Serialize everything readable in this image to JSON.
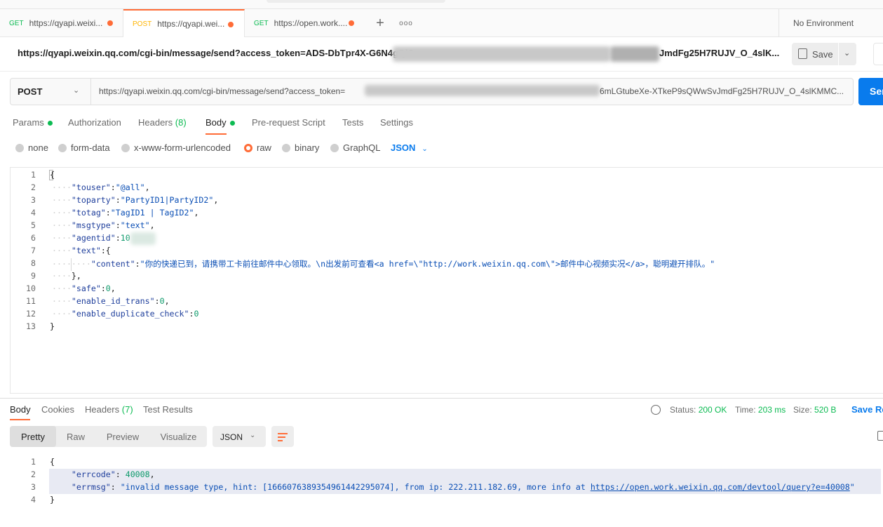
{
  "tabs": [
    {
      "method": "GET",
      "url": "https://qyapi.weixi..."
    },
    {
      "method": "POST",
      "url": "https://qyapi.wei..."
    },
    {
      "method": "GET",
      "url": "https://open.work...."
    }
  ],
  "new_tab": "+",
  "more_tabs": "ooo",
  "environment": "No Environment",
  "title_url": "https://qyapi.weixin.qq.com/cgi-bin/message/send?access_token=ADS-DbTpr4X-G6N4gQlS",
  "title_url_tail": "JmdFg25H7RUJV_O_4slK...",
  "save_label": "Save",
  "request": {
    "method": "POST",
    "url_prefix": "https://qyapi.weixin.qq.com/cgi-bin/message/send?access_token=",
    "url_tail": "6mLGtubeXe-XTkeP9sQWwSvJmdFg25H7RUJV_O_4slKMMC...",
    "send_label": "Send"
  },
  "request_tabs": {
    "params": "Params",
    "authorization": "Authorization",
    "headers": "Headers",
    "headers_count": "(8)",
    "body": "Body",
    "prerequest": "Pre-request Script",
    "tests": "Tests",
    "settings": "Settings"
  },
  "body_types": {
    "none": "none",
    "form_data": "form-data",
    "urlencoded": "x-www-form-urlencoded",
    "raw": "raw",
    "binary": "binary",
    "graphql": "GraphQL",
    "format": "JSON"
  },
  "request_body": {
    "line_numbers": [
      "1",
      "2",
      "3",
      "4",
      "5",
      "6",
      "7",
      "8",
      "9",
      "10",
      "11",
      "12",
      "13"
    ],
    "open_brace": "{",
    "touser_key": "\"touser\"",
    "touser_val": "\"@all\"",
    "toparty_key": "\"toparty\"",
    "toparty_val": "\"PartyID1|PartyID2\"",
    "totag_key": "\"totag\"",
    "totag_val": "\"TagID1 | TagID2\"",
    "msgtype_key": "\"msgtype\"",
    "msgtype_val": "\"text\"",
    "agentid_key": "\"agentid\"",
    "agentid_val": "10",
    "text_key": "\"text\"",
    "content_key": "\"content\"",
    "content_val": "\"你的快递已到，请携带工卡前往邮件中心领取。\\n出发前可查看<a href=\\\"http://work.weixin.qq.com\\\">邮件中心视频实况</a>，聪明避开排队。\"",
    "close_inner": "},",
    "safe_key": "\"safe\"",
    "safe_val": "0",
    "enable_id_trans_key": "\"enable_id_trans\"",
    "enable_id_trans_val": "0",
    "enable_duplicate_check_key": "\"enable_duplicate_check\"",
    "enable_duplicate_check_val": "0",
    "close_brace": "}"
  },
  "response_tabs": {
    "body": "Body",
    "cookies": "Cookies",
    "headers": "Headers",
    "headers_count": "(7)",
    "test_results": "Test Results"
  },
  "response_status": {
    "status_label": "Status:",
    "status_value": "200 OK",
    "time_label": "Time:",
    "time_value": "203 ms",
    "size_label": "Size:",
    "size_value": "520 B",
    "save_response": "Save Response"
  },
  "response_view": {
    "pretty": "Pretty",
    "raw": "Raw",
    "preview": "Preview",
    "visualize": "Visualize",
    "format": "JSON"
  },
  "response_body": {
    "line_numbers": [
      "1",
      "2",
      "3",
      "4"
    ],
    "open_brace": "{",
    "errcode_key": "\"errcode\"",
    "errcode_val": "40008",
    "errmsg_key": "\"errmsg\"",
    "errmsg_val_prefix": "\"invalid message type, hint: [1666076389354961442295074], from ip: 222.211.182.69, more info at ",
    "errmsg_link": "https://open.work.weixin.qq.com/devtool/query?e=40008",
    "errmsg_val_suffix": "\"",
    "close_brace": "}"
  },
  "colors": {
    "accent_orange": "#ff6c37",
    "send_blue": "#097bed",
    "success_green": "#0cbb52",
    "get_green": "#0cbb52",
    "post_yellow": "#ffb400"
  },
  "icons": [
    "save-icon",
    "chevron-down-icon",
    "globe-icon",
    "wrap-lines-icon",
    "copy-icon",
    "more-icon",
    "plus-icon"
  ]
}
